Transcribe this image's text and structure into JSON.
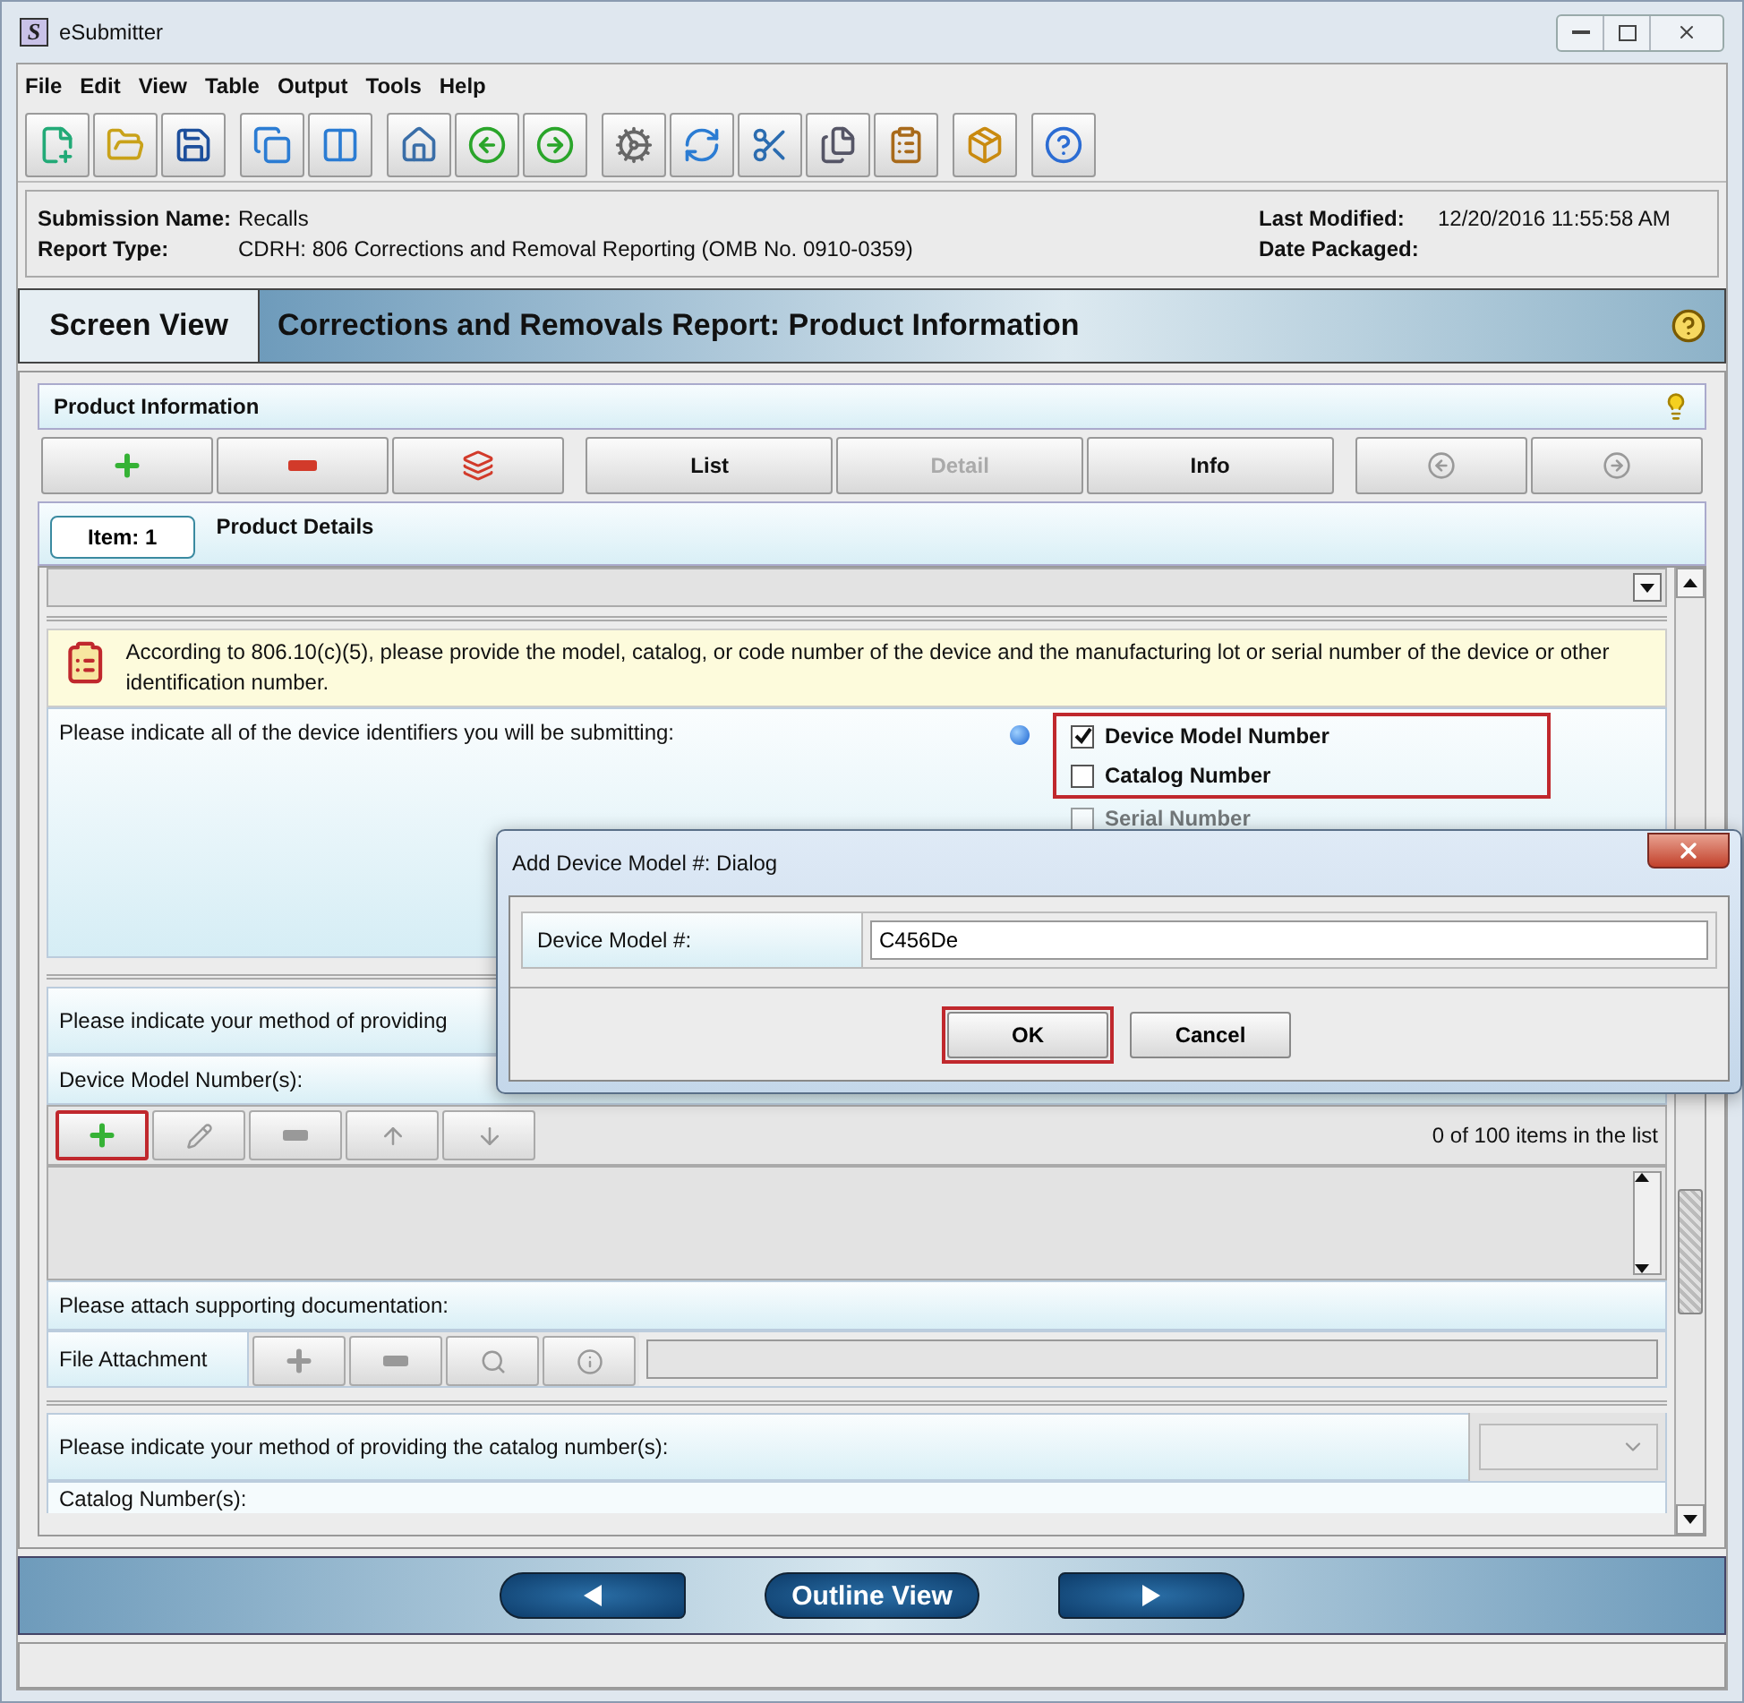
{
  "window": {
    "logo": "S",
    "title": "eSubmitter"
  },
  "menu": [
    {
      "label": "File"
    },
    {
      "label": "Edit"
    },
    {
      "label": "View"
    },
    {
      "label": "Table"
    },
    {
      "label": "Output"
    },
    {
      "label": "Tools"
    },
    {
      "label": "Help"
    }
  ],
  "submission": {
    "left": [
      {
        "label": "Submission Name:",
        "value": "Recalls"
      },
      {
        "label": "Report Type:",
        "value": "CDRH: 806 Corrections and Removal Reporting (OMB No. 0910-0359)"
      }
    ],
    "right": [
      {
        "label": "Last Modified:",
        "value": "12/20/2016 11:55:58 AM"
      },
      {
        "label": "Date Packaged:"
      }
    ]
  },
  "screen": {
    "tab": "Screen View",
    "title": "Corrections and Removals Report: Product Information"
  },
  "panel": {
    "title": "Product Information",
    "buttons": [
      {
        "kind": "add",
        "disabled": false
      },
      {
        "kind": "remove",
        "disabled": false
      },
      {
        "kind": "copy",
        "disabled": false
      },
      {
        "kind": "text",
        "label": "List",
        "disabled": false
      },
      {
        "kind": "text",
        "label": "Detail",
        "disabled": true
      },
      {
        "kind": "text",
        "label": "Info",
        "disabled": false
      },
      {
        "kind": "prev",
        "disabled": true
      },
      {
        "kind": "next",
        "disabled": true
      }
    ]
  },
  "item": {
    "tab": "Item: 1",
    "title": "Product Details"
  },
  "note": "According to 806.10(c)(5), please provide the model, catalog, or code number of the device and the manufacturing lot or serial number of the device or other identification number.",
  "identifiers": {
    "question": "Please indicate all of the device identifiers you will be submitting:",
    "options": [
      {
        "label": "Device Model Number",
        "checked": true,
        "highlighted": true,
        "dimmed": false
      },
      {
        "label": "Catalog Number",
        "checked": false,
        "highlighted": true,
        "dimmed": false
      },
      {
        "label": "Serial Number",
        "checked": false,
        "highlighted": false,
        "dimmed": true
      }
    ]
  },
  "model_method": {
    "question": "Please indicate your method of providing"
  },
  "model_list": {
    "label": "Device Model Number(s):",
    "count": "0 of 100 items in the list",
    "tools": [
      {
        "kind": "add",
        "disabled": false,
        "highlighted": true
      },
      {
        "kind": "edit",
        "disabled": true,
        "highlighted": false
      },
      {
        "kind": "remove",
        "disabled": true,
        "highlighted": false
      },
      {
        "kind": "up",
        "disabled": true,
        "highlighted": false
      },
      {
        "kind": "down",
        "disabled": true,
        "highlighted": false
      }
    ]
  },
  "attachment": {
    "prompt": "Please attach supporting documentation:",
    "label": "File Attachment",
    "tools": [
      {
        "kind": "add"
      },
      {
        "kind": "remove"
      },
      {
        "kind": "search"
      },
      {
        "kind": "info"
      }
    ]
  },
  "catalog_method": {
    "question": "Please indicate your method of providing the catalog number(s):"
  },
  "catalog_list": {
    "label": "Catalog Number(s):"
  },
  "nav": {
    "outline": "Outline View"
  },
  "dialog": {
    "title": "Add Device Model #: Dialog",
    "field_label": "Device Model #:",
    "value": "C456De",
    "buttons": [
      {
        "label": "OK",
        "highlighted": true
      },
      {
        "label": "Cancel",
        "highlighted": false
      }
    ]
  }
}
